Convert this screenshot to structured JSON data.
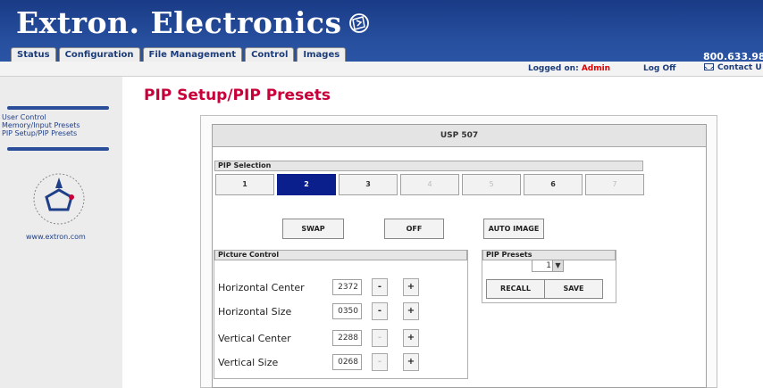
{
  "brand": {
    "logo_text": "Extron. Electronics"
  },
  "tabs": [
    {
      "label": "Status"
    },
    {
      "label": "Configuration"
    },
    {
      "label": "File Management"
    },
    {
      "label": "Control"
    },
    {
      "label": "Images"
    }
  ],
  "header": {
    "phone": "800.633.98",
    "logged_prefix": "Logged on: ",
    "logged_user": "Admin",
    "log_off": "Log Off",
    "contact": "Contact U"
  },
  "sidebar": {
    "items": [
      {
        "label": "User Control"
      },
      {
        "label": "Memory/Input Presets"
      },
      {
        "label": "PIP Setup/PIP Presets"
      }
    ],
    "site": "www.extron.com"
  },
  "page_title": "PIP Setup/PIP Presets",
  "device": {
    "name": "USP 507"
  },
  "pip_selection": {
    "title": "PIP Selection",
    "buttons": [
      "1",
      "2",
      "3",
      "4",
      "5",
      "6",
      "7"
    ],
    "selected": "2"
  },
  "actions": {
    "swap": "SWAP",
    "off": "OFF",
    "auto_image": "AUTO IMAGE"
  },
  "picture_control": {
    "title": "Picture Control",
    "rows": [
      {
        "label": "Horizontal Center",
        "value": "2372"
      },
      {
        "label": "Horizontal Size",
        "value": "0350"
      },
      {
        "label": "Vertical Center",
        "value": "2288"
      },
      {
        "label": "Vertical Size",
        "value": "0268"
      }
    ],
    "minus": "-",
    "plus": "+"
  },
  "pip_presets": {
    "title": "PIP Presets",
    "selected": "1",
    "recall": "RECALL",
    "save": "SAVE"
  },
  "colors": {
    "header_blue": "#27509f",
    "title_red": "#c8003a",
    "selected_blue": "#0a1e8c",
    "user_red": "#e00000"
  }
}
